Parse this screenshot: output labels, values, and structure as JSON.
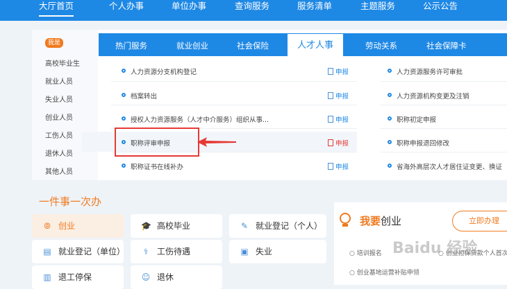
{
  "topnav": {
    "items": [
      "大厅首页",
      "个人办事",
      "单位办事",
      "查询服务",
      "服务清单",
      "主题服务",
      "公示公告"
    ]
  },
  "who": {
    "badge": "我是",
    "items": [
      "高校毕业生",
      "就业人员",
      "失业人员",
      "创业人员",
      "工伤人员",
      "退休人员",
      "其他人员"
    ]
  },
  "tabs": [
    "热门服务",
    "就业创业",
    "社会保险",
    "人才人事",
    "劳动关系",
    "社会保障卡"
  ],
  "services_left": [
    "人力资源分支机构登记",
    "档案转出",
    "授权人力资源服务（人才中介服务）组织从事...",
    "职称评审申报",
    "职称证书在线补办"
  ],
  "apply_label": "申报",
  "services_right": [
    "人力资源服务许可审批",
    "人力资源机构变更及注销",
    "职称初定申报",
    "职称申报退回修改",
    "省海外高层次人才居住证变更、换证"
  ],
  "section": {
    "title": "一件事一次办"
  },
  "cards": [
    {
      "label": "创业",
      "icon": "⦾"
    },
    {
      "label": "高校毕业",
      "icon": "🎓"
    },
    {
      "label": "就业登记（个人）",
      "icon": "✎"
    },
    {
      "label": "就业登记（单位）",
      "icon": "▤"
    },
    {
      "label": "工伤待遇",
      "icon": "⚕"
    },
    {
      "label": "失业",
      "icon": "▣"
    },
    {
      "label": "退工停保",
      "icon": "▥"
    },
    {
      "label": "退休",
      "icon": "☺"
    }
  ],
  "start_panel": {
    "title_strong": "我要",
    "title_rest": "创业",
    "button": "立即办理",
    "links": [
      "培训报名",
      "创业基地运营补贴申领",
      "创业担保贷款个人首次"
    ]
  },
  "watermark": "Baidu 经验",
  "colors": {
    "primary": "#1e88e5",
    "accent": "#f07a1f",
    "highlight": "#e53935"
  }
}
